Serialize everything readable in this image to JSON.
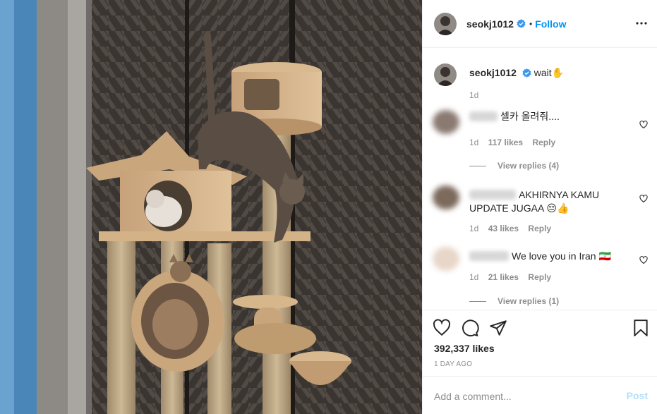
{
  "post": {
    "username": "seokj1012",
    "follow_label": "Follow",
    "caption": {
      "username": "seokj1012",
      "text": "wait✋",
      "time": "1d"
    },
    "comments": [
      {
        "text": "셀카 올려줘....",
        "time": "1d",
        "likes": "117 likes",
        "reply_label": "Reply",
        "view_replies": "View replies (4)"
      },
      {
        "text": "AKHIRNYA KAMU UPDATE JUGAA 😔👍",
        "time": "1d",
        "likes": "43 likes",
        "reply_label": "Reply",
        "view_replies": ""
      },
      {
        "text": "We love you in Iran 🇮🇷",
        "time": "1d",
        "likes": "21 likes",
        "reply_label": "Reply",
        "view_replies": "View replies (1)"
      }
    ],
    "likes_total": "392,337 likes",
    "time_ago": "1 DAY AGO",
    "comment_placeholder": "Add a comment...",
    "post_label": "Post",
    "colors": {
      "accent": "#0095f6",
      "post_disabled": "#b2dffc",
      "muted": "#8e8e8e",
      "text": "#262626"
    },
    "icons": [
      "verified-badge-icon",
      "more-options-icon",
      "heart-icon",
      "comment-icon",
      "share-icon",
      "bookmark-icon"
    ]
  }
}
